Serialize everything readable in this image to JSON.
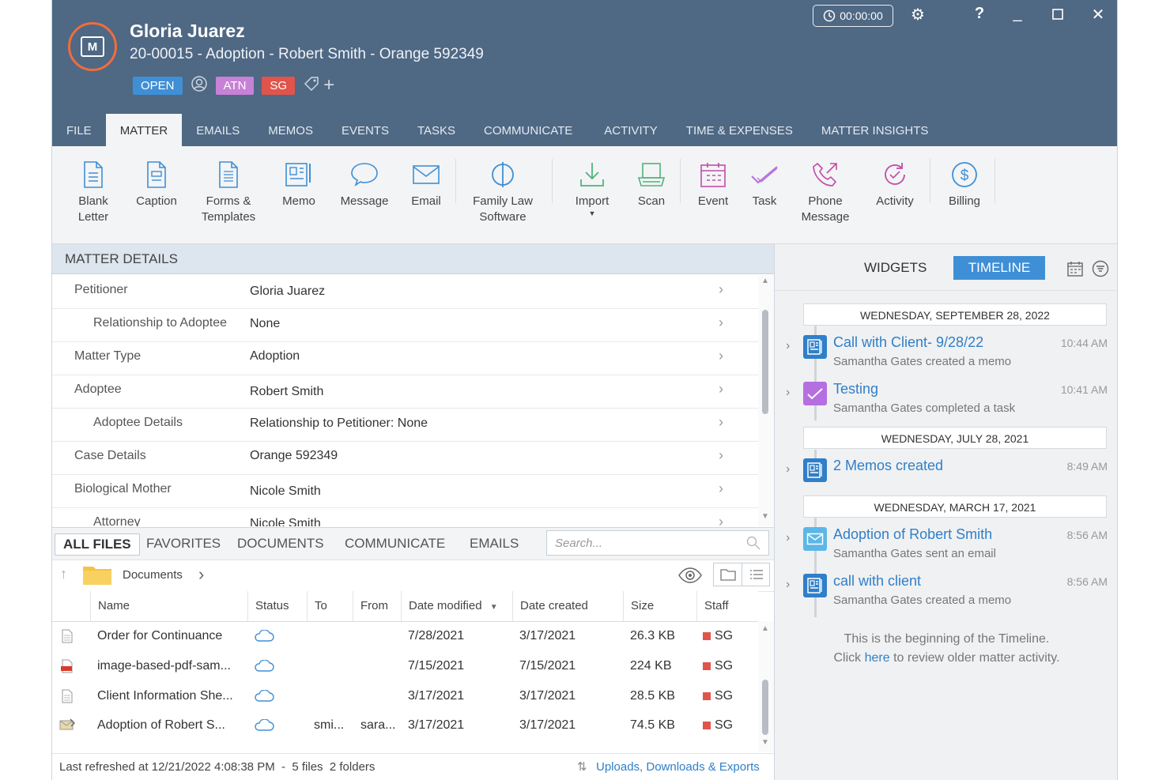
{
  "header": {
    "client_name": "Gloria Juarez",
    "matter_line": "20-00015 - Adoption - Robert Smith - Orange 592349",
    "status_tag": "OPEN",
    "tag_atn": "ATN",
    "tag_sg": "SG",
    "timer": "00:00:00",
    "icons": [
      "matter-logo-icon",
      "clock-icon",
      "gear-icon",
      "help-icon",
      "minimize-icon",
      "maximize-icon",
      "close-icon",
      "contact-icon",
      "tag-icon",
      "plus-icon"
    ]
  },
  "tabs": [
    "FILE",
    "MATTER",
    "EMAILS",
    "MEMOS",
    "EVENTS",
    "TASKS",
    "COMMUNICATE",
    "ACTIVITY",
    "TIME & EXPENSES",
    "MATTER INSIGHTS"
  ],
  "ribbon": [
    {
      "l1": "Blank",
      "l2": "Letter",
      "icon": "document-icon"
    },
    {
      "l1": "Caption",
      "l2": "",
      "icon": "caption-icon"
    },
    {
      "l1": "Forms &",
      "l2": "Templates",
      "icon": "forms-icon"
    },
    {
      "l1": "Memo",
      "l2": "",
      "icon": "memo-icon"
    },
    {
      "l1": "Message",
      "l2": "",
      "icon": "message-icon"
    },
    {
      "l1": "Email",
      "l2": "",
      "icon": "email-icon"
    },
    {
      "l1": "Family Law",
      "l2": "Software",
      "icon": "family-law-icon"
    },
    {
      "l1": "Import",
      "l2": "",
      "icon": "import-icon"
    },
    {
      "l1": "Scan",
      "l2": "",
      "icon": "scan-icon"
    },
    {
      "l1": "Event",
      "l2": "",
      "icon": "calendar-icon"
    },
    {
      "l1": "Task",
      "l2": "",
      "icon": "task-icon"
    },
    {
      "l1": "Phone",
      "l2": "Message",
      "icon": "phone-icon"
    },
    {
      "l1": "Activity",
      "l2": "",
      "icon": "activity-icon"
    },
    {
      "l1": "Billing",
      "l2": "",
      "icon": "billing-icon"
    }
  ],
  "matter_details": {
    "title": "MATTER DETAILS",
    "rows": [
      {
        "label": "Petitioner",
        "value": "Gloria Juarez"
      },
      {
        "label": "Relationship to Adoptee",
        "value": "None"
      },
      {
        "label": "Matter Type",
        "value": "Adoption"
      },
      {
        "label": "Adoptee",
        "value": "Robert Smith"
      },
      {
        "label": "Adoptee Details",
        "value": "Relationship to Petitioner: None"
      },
      {
        "label": "Case Details",
        "value": "Orange 592349"
      },
      {
        "label": "Biological Mother",
        "value": "Nicole Smith"
      },
      {
        "label": "Attorney",
        "value": "Nicole Smith"
      }
    ]
  },
  "files": {
    "tabs": [
      "ALL FILES",
      "FAVORITES",
      "DOCUMENTS",
      "COMMUNICATE",
      "EMAILS"
    ],
    "search_placeholder": "Search...",
    "path": "Documents",
    "columns": [
      "Name",
      "Status",
      "To",
      "From",
      "Date modified",
      "Date created",
      "Size",
      "Staff"
    ],
    "rows": [
      {
        "name": "Order for Continuance",
        "to": "",
        "from": "",
        "modified": "7/28/2021",
        "created": "3/17/2021",
        "size": "26.3 KB",
        "staff": "SG",
        "icon": "doc"
      },
      {
        "name": "image-based-pdf-sam...",
        "to": "",
        "from": "",
        "modified": "7/15/2021",
        "created": "7/15/2021",
        "size": "224 KB",
        "staff": "SG",
        "icon": "pdf"
      },
      {
        "name": "Client Information She...",
        "to": "",
        "from": "",
        "modified": "3/17/2021",
        "created": "3/17/2021",
        "size": "28.5 KB",
        "staff": "SG",
        "icon": "doc"
      },
      {
        "name": "Adoption of Robert S...",
        "to": "smi...",
        "from": "sara...",
        "modified": "3/17/2021",
        "created": "3/17/2021",
        "size": "74.5 KB",
        "staff": "SG",
        "icon": "mail"
      }
    ],
    "status_left": "Last refreshed at 12/21/2022 4:08:38 PM  -  5 files  2 folders",
    "status_right": "Uploads, Downloads & Exports"
  },
  "right_panel": {
    "widgets_label": "WIDGETS",
    "timeline_label": "TIMELINE",
    "dates": [
      "WEDNESDAY, SEPTEMBER 28, 2022",
      "WEDNESDAY, JULY 28, 2021",
      "WEDNESDAY, MARCH 17, 2021"
    ],
    "items": [
      {
        "title": "Call with Client- 9/28/22",
        "sub": "Samantha Gates created a memo",
        "time": "10:44 AM",
        "kind": "memo"
      },
      {
        "title": "Testing",
        "sub": "Samantha Gates completed a task",
        "time": "10:41 AM",
        "kind": "task"
      },
      {
        "title": "2 Memos created",
        "sub": "",
        "time": "8:49 AM",
        "kind": "memo"
      },
      {
        "title": "Adoption of Robert Smith",
        "sub": "Samantha Gates sent an email",
        "time": "8:56 AM",
        "kind": "email"
      },
      {
        "title": "call with client",
        "sub": "Samantha Gates created a memo",
        "time": "8:56 AM",
        "kind": "memo"
      }
    ],
    "begin_line1": "This is the beginning of the Timeline.",
    "begin_line2_pre": "Click ",
    "begin_link": "here",
    "begin_line2_post": " to review older matter activity."
  },
  "colors": {
    "header_bg": "#4f6884",
    "accent": "#3f8fd6",
    "logo_ring": "#f06d3c",
    "tag_atn": "#c781d6",
    "tag_sg": "#e0544b",
    "task": "#b56fe0"
  }
}
